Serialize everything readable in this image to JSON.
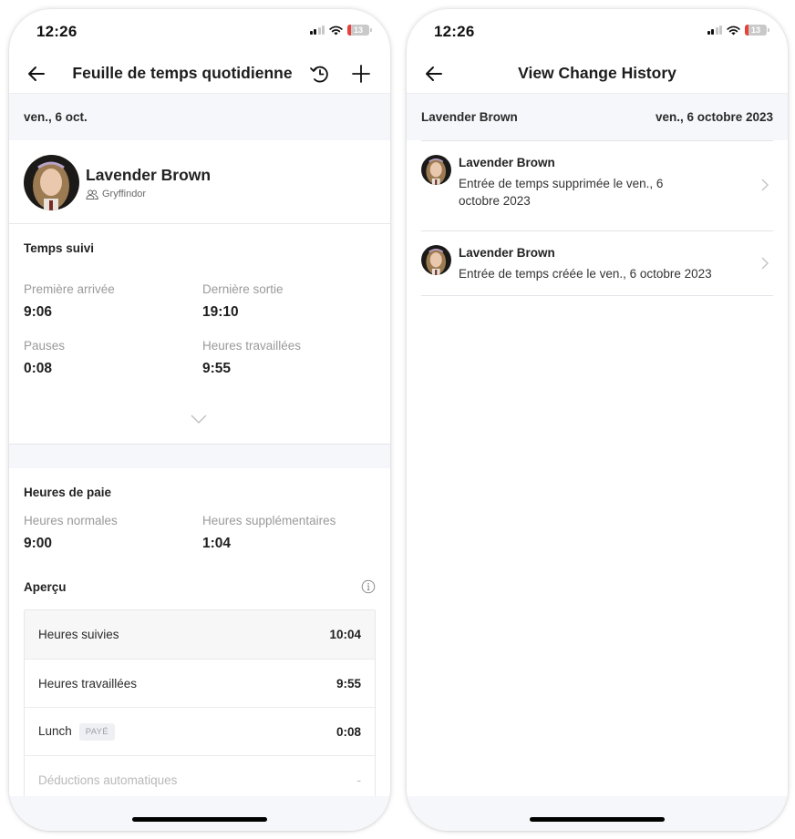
{
  "left_screen": {
    "status_bar": {
      "time": "12:26",
      "battery": "13"
    },
    "nav": {
      "title": "Feuille de temps quotidienne",
      "back_icon": "arrow-left-icon",
      "history_icon": "history-icon",
      "add_icon": "plus-icon"
    },
    "date": "ven., 6 oct.",
    "profile": {
      "name": "Lavender Brown",
      "team": "Gryffindor",
      "team_icon": "users-icon"
    },
    "tracked_time": {
      "title": "Temps suivi",
      "stats": [
        {
          "label": "Première arrivée",
          "value": "9:06"
        },
        {
          "label": "Dernière sortie",
          "value": "19:10"
        },
        {
          "label": "Pauses",
          "value": "0:08"
        },
        {
          "label": "Heures travaillées",
          "value": "9:55"
        }
      ],
      "expand_icon": "chevron-down-icon"
    },
    "pay_hours": {
      "title": "Heures de paie",
      "stats": [
        {
          "label": "Heures normales",
          "value": "9:00"
        },
        {
          "label": "Heures supplémentaires",
          "value": "1:04"
        }
      ]
    },
    "overview": {
      "title": "Aperçu",
      "info_icon": "info-icon",
      "rows": [
        {
          "label": "Heures suivies",
          "value": "10:04"
        },
        {
          "label": "Heures travaillées",
          "value": "9:55"
        },
        {
          "label": "Lunch",
          "badge": "PAYÉ",
          "value": "0:08"
        },
        {
          "label": "Déductions automatiques",
          "value": "-"
        }
      ]
    }
  },
  "right_screen": {
    "status_bar": {
      "time": "12:26",
      "battery": "13"
    },
    "nav": {
      "title": "View Change History",
      "back_icon": "arrow-left-icon"
    },
    "header": {
      "name": "Lavender Brown",
      "date": "ven., 6 octobre 2023"
    },
    "history": [
      {
        "name": "Lavender Brown",
        "description": "Entrée de temps supprimée le ven., 6 octobre 2023"
      },
      {
        "name": "Lavender Brown",
        "description": "Entrée de temps créée le ven., 6 octobre 2023"
      }
    ]
  },
  "colors": {
    "background_gray": "#f6f7fa",
    "text_primary": "#1f1f1f",
    "text_muted": "#9a9a9a",
    "battery_low": "#e8413c"
  }
}
